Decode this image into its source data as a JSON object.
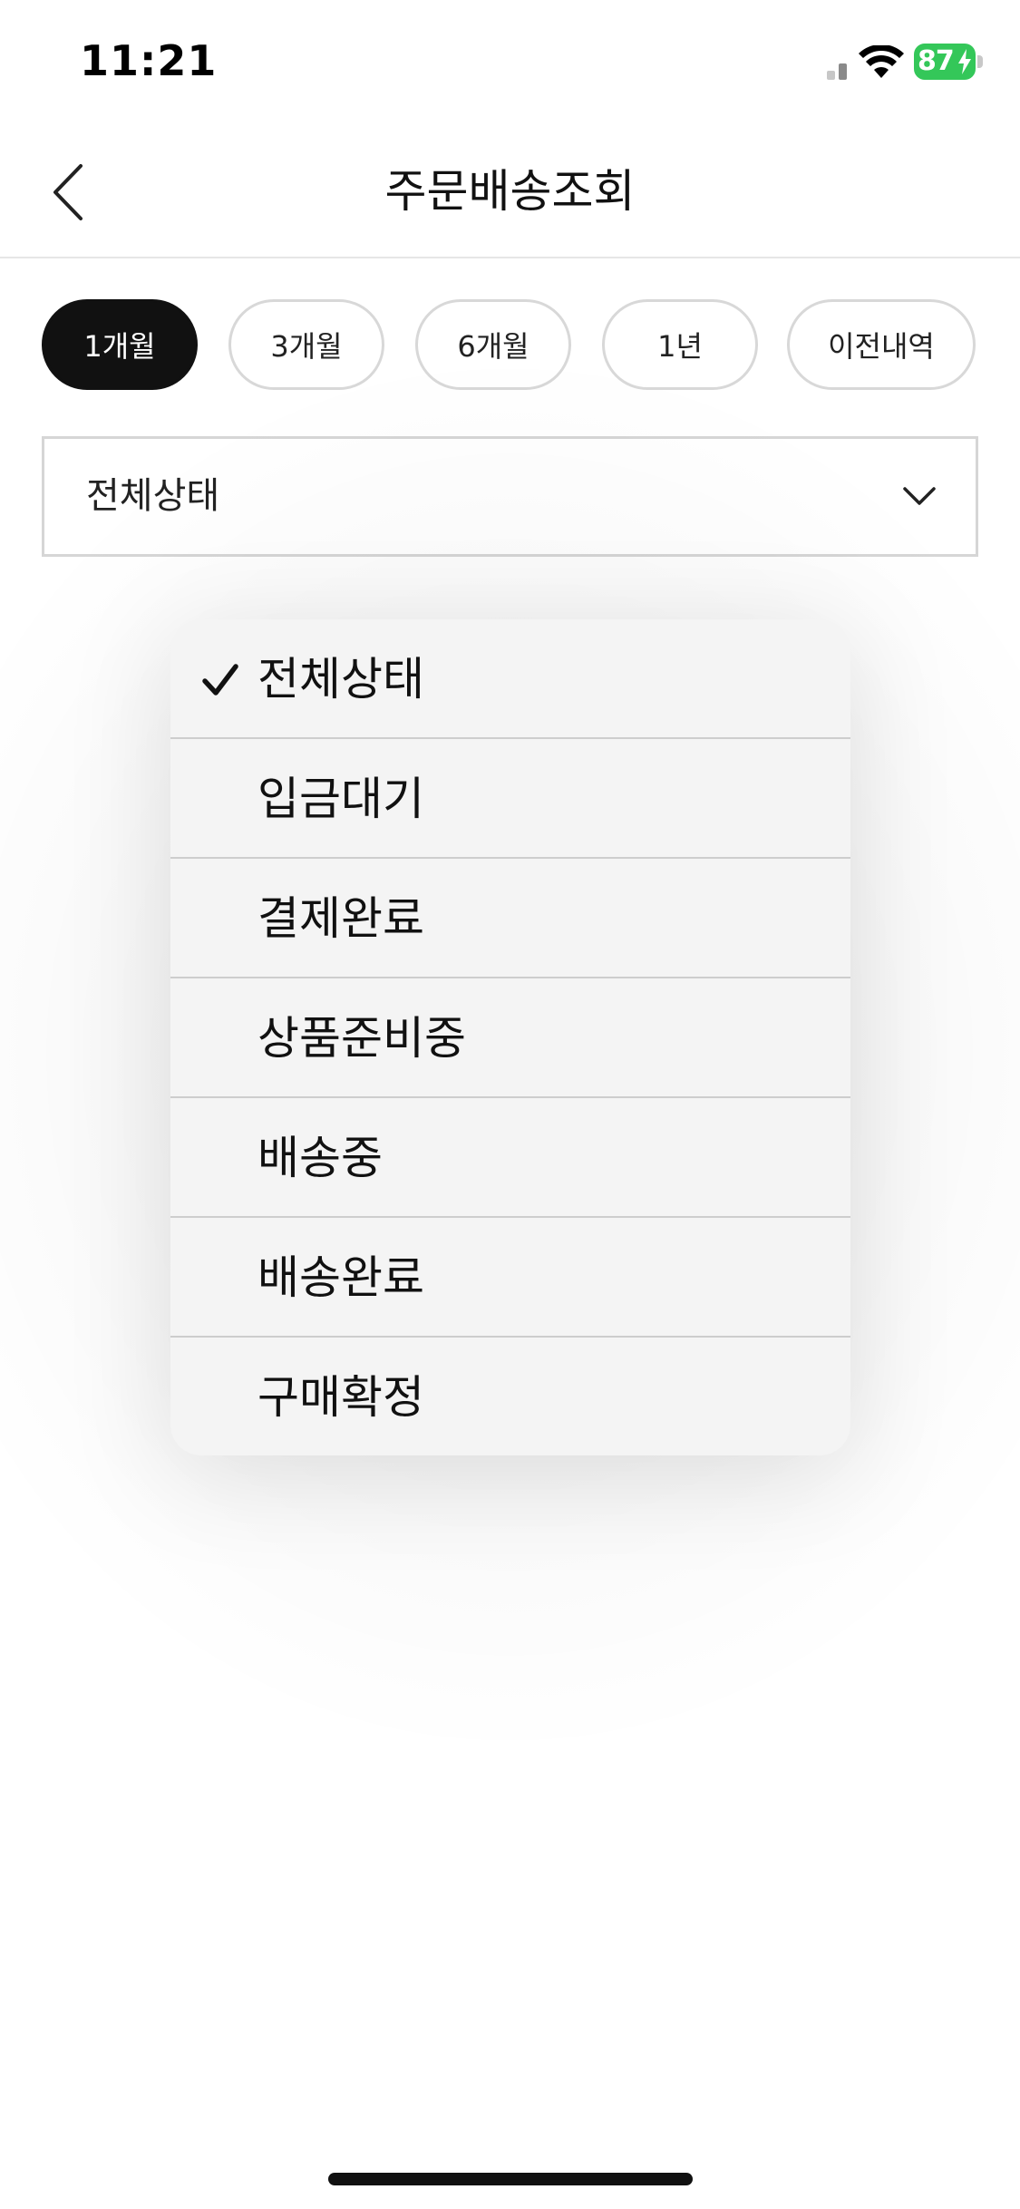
{
  "status_bar": {
    "time": "11:21",
    "battery_level": "87",
    "battery_color": "#34c759"
  },
  "header": {
    "title": "주문배송조회",
    "back_icon": "chevron-left-icon"
  },
  "period_filter": {
    "chips": [
      {
        "label": "1개월",
        "selected": true
      },
      {
        "label": "3개월",
        "selected": false
      },
      {
        "label": "6개월",
        "selected": false
      },
      {
        "label": "1년",
        "selected": false
      },
      {
        "label": "이전내역",
        "selected": false
      }
    ],
    "active_color": "#111111"
  },
  "status_filter": {
    "selected_value": "전체상태",
    "chevron_icon": "chevron-down-icon"
  },
  "dropdown": {
    "options": [
      {
        "label": "전체상태",
        "checked": true
      },
      {
        "label": "입금대기",
        "checked": false
      },
      {
        "label": "결제완료",
        "checked": false
      },
      {
        "label": "상품준비중",
        "checked": false
      },
      {
        "label": "배송중",
        "checked": false
      },
      {
        "label": "배송완료",
        "checked": false
      },
      {
        "label": "구매확정",
        "checked": false
      }
    ],
    "check_icon": "checkmark-icon"
  }
}
